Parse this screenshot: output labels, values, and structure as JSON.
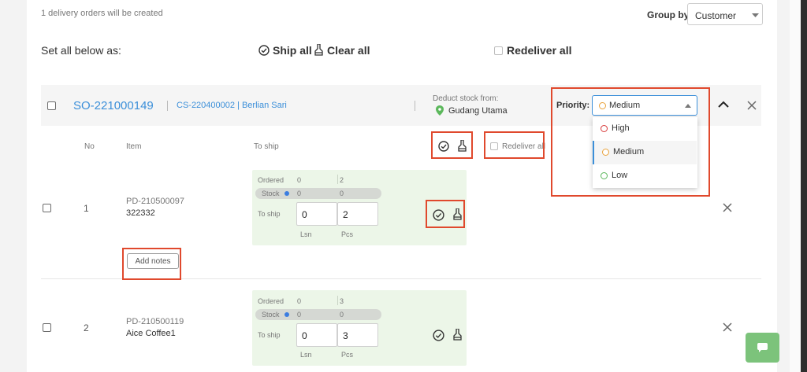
{
  "summary": {
    "created_text": "1 delivery orders will be created"
  },
  "group_by": {
    "label": "Group by:",
    "value": "Customer"
  },
  "bulk": {
    "label": "Set all below as:",
    "ship_all": "Ship all",
    "clear_all": "Clear all",
    "redeliver_all": "Redeliver all"
  },
  "order": {
    "so_number": "SO-221000149",
    "customer": "CS-220400002 | Berlian Sari",
    "deduct_label": "Deduct stock from:",
    "warehouse": "Gudang Utama",
    "priority_label": "Priority:",
    "priority_value": "Medium",
    "priority_options": [
      {
        "label": "High",
        "color": "#d83a3a"
      },
      {
        "label": "Medium",
        "color": "#e9a23b"
      },
      {
        "label": "Low",
        "color": "#5cb85c"
      }
    ]
  },
  "table_headers": {
    "no": "No",
    "item": "Item",
    "to_ship": "To ship",
    "redeliver_all": "Redeliver all"
  },
  "ship_card_labels": {
    "ordered": "Ordered",
    "stock": "Stock",
    "to_ship": "To ship",
    "unit1": "Lsn",
    "unit2": "Pcs"
  },
  "items": [
    {
      "no": "1",
      "code": "PD-210500097",
      "name": "322332",
      "ordered1": "0",
      "ordered2": "2",
      "stock1": "0",
      "stock2": "0",
      "ship1": "0",
      "ship2": "2",
      "notes_btn": "Add notes"
    },
    {
      "no": "2",
      "code": "PD-210500119",
      "name": "Aice Coffee1",
      "ordered1": "0",
      "ordered2": "3",
      "stock1": "0",
      "stock2": "0",
      "ship1": "0",
      "ship2": "3"
    }
  ],
  "colors": {
    "accent_blue": "#3b8fd9",
    "highlight": "#e0492d",
    "ship_card_bg": "#ecf6e8",
    "chat_green": "#7cc37b",
    "stock_dot": "#3b7de0"
  }
}
